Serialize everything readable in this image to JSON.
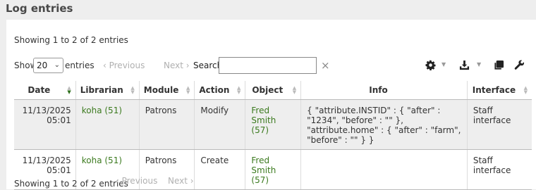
{
  "page": {
    "title": "Log entries"
  },
  "table_info": {
    "top": "Showing 1 to 2 of 2 entries",
    "bottom": "Showing 1 to 2 of 2 entries"
  },
  "controls": {
    "show_label": "Show",
    "page_length": "20",
    "entries_label": "entries",
    "previous": "‹ Previous",
    "next": "Next ›",
    "search_label": "Search:",
    "search_value": "",
    "clear_icon": "×",
    "icons": [
      "gear-icon",
      "download-icon",
      "copy-icon",
      "wrench-icon"
    ]
  },
  "columns": [
    "Date",
    "Librarian",
    "Module",
    "Action",
    "Object",
    "Info",
    "Interface"
  ],
  "rows": [
    {
      "date": "11/13/2025",
      "time": "05:01",
      "librarian": "koha (51)",
      "module": "Patrons",
      "action": "Modify",
      "object_name": "Fred Smith",
      "object_id": "(57)",
      "info": "{ \"attribute.INSTID\" : { \"after\" : \"1234\", \"before\" : \"\" }, \"attribute.home\" : { \"after\" : \"farm\", \"before\" : \"\" } }",
      "interface": "Staff interface"
    },
    {
      "date": "11/13/2025",
      "time": "05:01",
      "librarian": "koha (51)",
      "module": "Patrons",
      "action": "Create",
      "object_name": "Fred Smith",
      "object_id": "(57)",
      "info": "",
      "interface": "Staff interface"
    }
  ],
  "colors": {
    "link": "#3b7a1e",
    "sort_active": "#2c6e1a",
    "row_stripe": "#eeeeee"
  }
}
